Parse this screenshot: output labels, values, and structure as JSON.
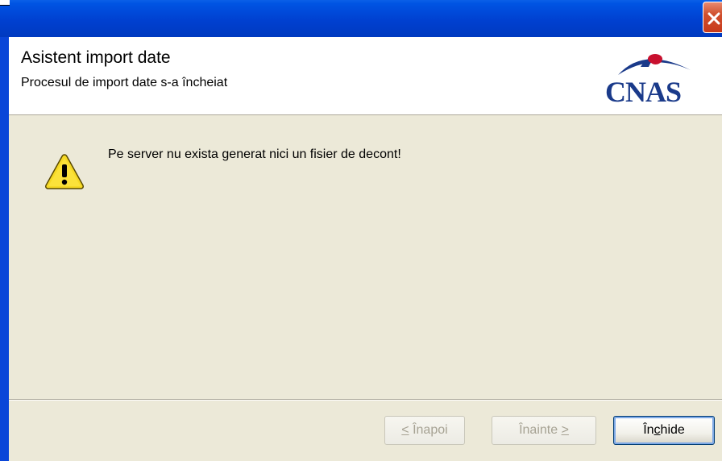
{
  "window": {
    "close_icon": "close-icon",
    "close_color": "#d0502e"
  },
  "header": {
    "title": "Asistent import date",
    "subtitle": "Procesul de import date s-a încheiat",
    "logo_text": "CNAS"
  },
  "message": {
    "icon": "warning-icon",
    "text": "Pe server nu exista generat nici un fisier de decont!"
  },
  "buttons": {
    "back": {
      "mnemonic": "<",
      "label": " Înapoi",
      "enabled": false
    },
    "next": {
      "label": "Înainte ",
      "mnemonic": ">",
      "enabled": false
    },
    "close": {
      "prefix": "În",
      "mnemonic": "c",
      "suffix": "hide",
      "enabled": true
    }
  },
  "colors": {
    "titlebar": "#0054e3",
    "client_bg": "#ece9d8",
    "logo_blue": "#1a3a8a",
    "logo_red": "#c8102e"
  }
}
